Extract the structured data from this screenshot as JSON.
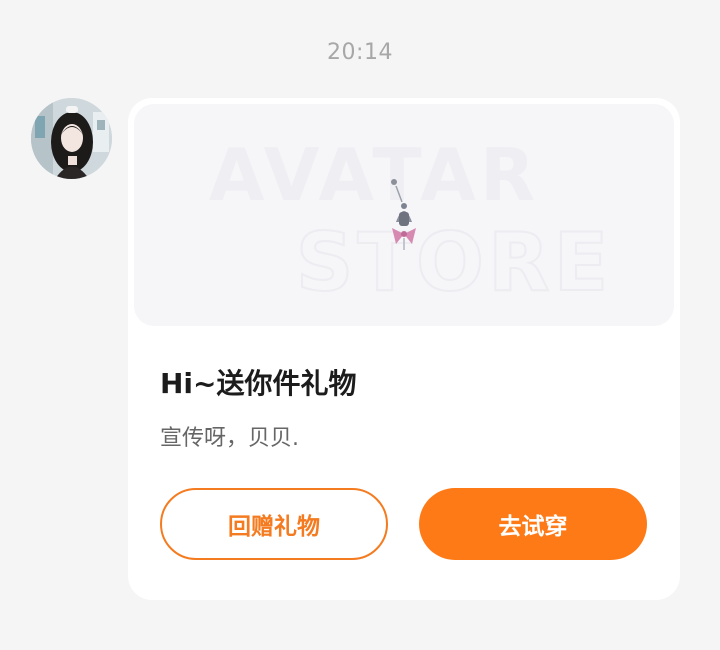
{
  "chat": {
    "timestamp": "20:14"
  },
  "message": {
    "sender_avatar_icon": "user-avatar",
    "banner": {
      "line1": "AVATAR",
      "line2": "STORE",
      "item_icon": "gift-ornament-icon"
    },
    "title": "Hi~送你件礼物",
    "text": "宣传呀，贝贝.",
    "buttons": {
      "return_gift": "回赠礼物",
      "try_on": "去试穿"
    }
  },
  "colors": {
    "accent": "#fe7a16",
    "accent_border": "#f47b20",
    "background": "#f5f5f6",
    "card": "#ffffff",
    "timestamp": "#a7a7a7"
  }
}
